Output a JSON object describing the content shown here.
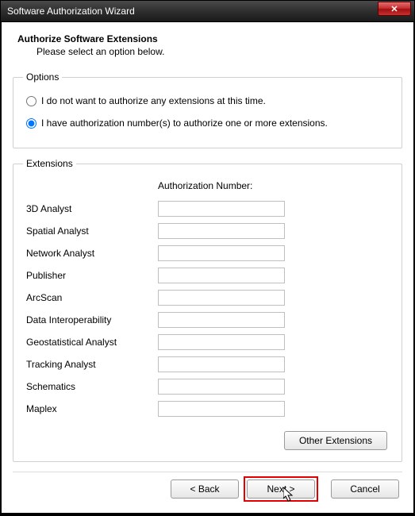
{
  "window": {
    "title": "Software Authorization Wizard"
  },
  "header": {
    "title": "Authorize Software Extensions",
    "subtitle": "Please select an option below."
  },
  "options": {
    "legend": "Options",
    "radio_none": "I do not want to authorize any extensions at this time.",
    "radio_have": "I have authorization number(s) to authorize one or more extensions."
  },
  "extensions": {
    "legend": "Extensions",
    "column_header": "Authorization Number:",
    "rows": [
      {
        "label": "3D Analyst",
        "value": ""
      },
      {
        "label": "Spatial Analyst",
        "value": ""
      },
      {
        "label": "Network Analyst",
        "value": ""
      },
      {
        "label": "Publisher",
        "value": ""
      },
      {
        "label": "ArcScan",
        "value": ""
      },
      {
        "label": "Data Interoperability",
        "value": ""
      },
      {
        "label": "Geostatistical Analyst",
        "value": ""
      },
      {
        "label": "Tracking Analyst",
        "value": ""
      },
      {
        "label": "Schematics",
        "value": ""
      },
      {
        "label": "Maplex",
        "value": ""
      }
    ],
    "other_button": "Other Extensions"
  },
  "footer": {
    "back": "< Back",
    "next": "Next >",
    "cancel": "Cancel"
  }
}
